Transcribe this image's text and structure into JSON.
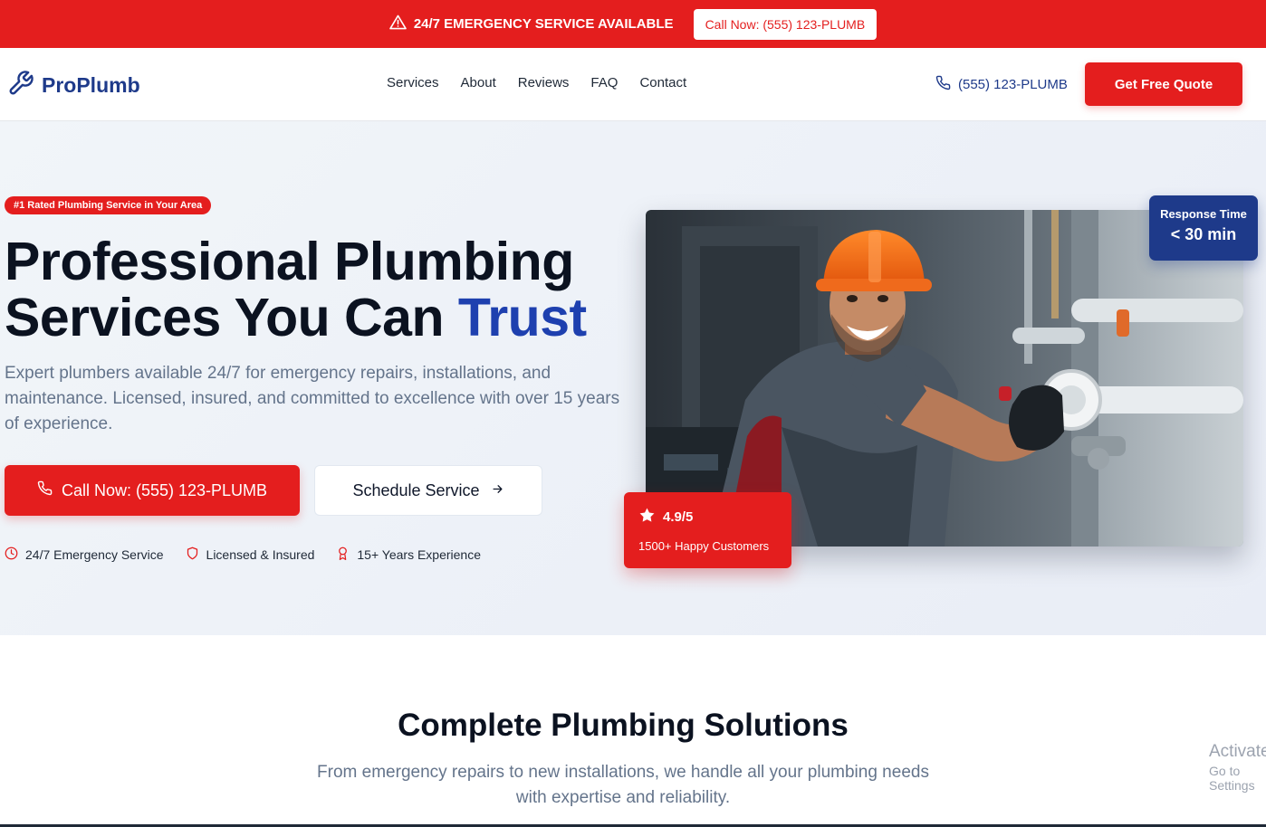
{
  "emergency_bar": {
    "text": "24/7 EMERGENCY SERVICE AVAILABLE",
    "call_button": "Call Now: (555) 123-PLUMB",
    "icon": "warning-triangle-icon"
  },
  "nav": {
    "logo": "ProPlumb",
    "logo_icon": "wrench-icon",
    "links": [
      "Services",
      "About",
      "Reviews",
      "FAQ",
      "Contact"
    ],
    "phone": "(555) 123-PLUMB",
    "phone_icon": "phone-icon",
    "quote_button": "Get Free Quote"
  },
  "hero": {
    "badge": "#1 Rated Plumbing Service in Your Area",
    "title_part1": "Professional Plumbing Services You Can ",
    "title_accent": "Trust",
    "subtitle": "Expert plumbers available 24/7 for emergency repairs, installations, and maintenance. Licensed, insured, and committed to excellence with over 15 years of experience.",
    "call_button": "Call Now: (555) 123-PLUMB",
    "schedule_button": "Schedule Service",
    "features": [
      {
        "label": "24/7 Emergency Service",
        "icon": "clock-icon"
      },
      {
        "label": "Licensed & Insured",
        "icon": "shield-icon"
      },
      {
        "label": "15+ Years Experience",
        "icon": "award-icon"
      }
    ],
    "response_card": {
      "label": "Response Time",
      "value": "< 30 min"
    },
    "rating_card": {
      "rating": "4.9/5",
      "customers": "1500+ Happy Customers",
      "icon": "star-icon"
    }
  },
  "solutions": {
    "title": "Complete Plumbing Solutions",
    "subtitle": "From emergency repairs to new installations, we handle all your plumbing needs with expertise and reliability."
  },
  "watermark": {
    "line1": "Activate",
    "line2": "Go to Settings"
  },
  "colors": {
    "brand_red": "#e41e1e",
    "brand_blue": "#1e3a8a",
    "accent_blue": "#1e40af"
  }
}
